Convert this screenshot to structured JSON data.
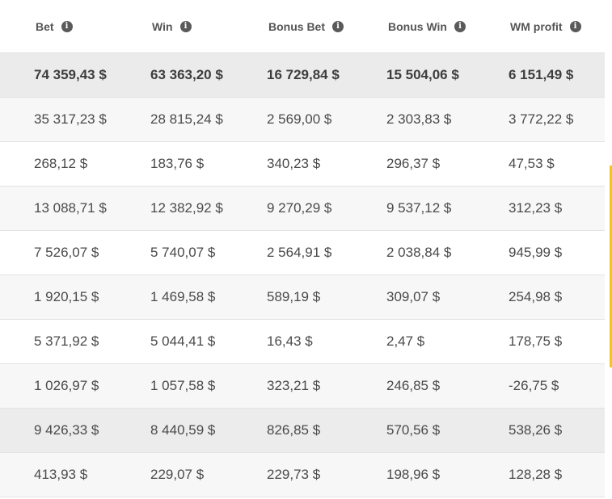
{
  "headers": [
    {
      "label": "Bet",
      "icon": "info-icon"
    },
    {
      "label": "Win",
      "icon": "info-icon"
    },
    {
      "label": "Bonus Bet",
      "icon": "info-icon"
    },
    {
      "label": "Bonus Win",
      "icon": "info-icon"
    },
    {
      "label": "WM profit",
      "icon": "info-icon"
    }
  ],
  "info_glyph": "i",
  "totals": [
    "74 359,43 $",
    "63 363,20 $",
    "16 729,84 $",
    "15 504,06 $",
    "6 151,49 $"
  ],
  "rows": [
    [
      "35 317,23 $",
      "28 815,24 $",
      "2 569,00 $",
      "2 303,83 $",
      "3 772,22 $"
    ],
    [
      "268,12 $",
      "183,76 $",
      "340,23 $",
      "296,37 $",
      "47,53 $"
    ],
    [
      "13 088,71 $",
      "12 382,92 $",
      "9 270,29 $",
      "9 537,12 $",
      "312,23 $"
    ],
    [
      "7 526,07 $",
      "5 740,07 $",
      "2 564,91 $",
      "2 038,84 $",
      "945,99 $"
    ],
    [
      "1 920,15 $",
      "1 469,58 $",
      "589,19 $",
      "309,07 $",
      "254,98 $"
    ],
    [
      "5 371,92 $",
      "5 044,41 $",
      "16,43 $",
      "2,47 $",
      "178,75 $"
    ],
    [
      "1 026,97 $",
      "1 057,58 $",
      "323,21 $",
      "246,85 $",
      "-26,75 $"
    ],
    [
      "9 426,33 $",
      "8 440,59 $",
      "826,85 $",
      "570,56 $",
      "538,26 $"
    ],
    [
      "413,93 $",
      "229,07 $",
      "229,73 $",
      "198,96 $",
      "128,28 $"
    ]
  ],
  "colors": {
    "header_text": "#555555",
    "total_row_bg": "#ebebeb",
    "row_alt_bg": "#f7f7f7",
    "accent": "#f5c518"
  }
}
